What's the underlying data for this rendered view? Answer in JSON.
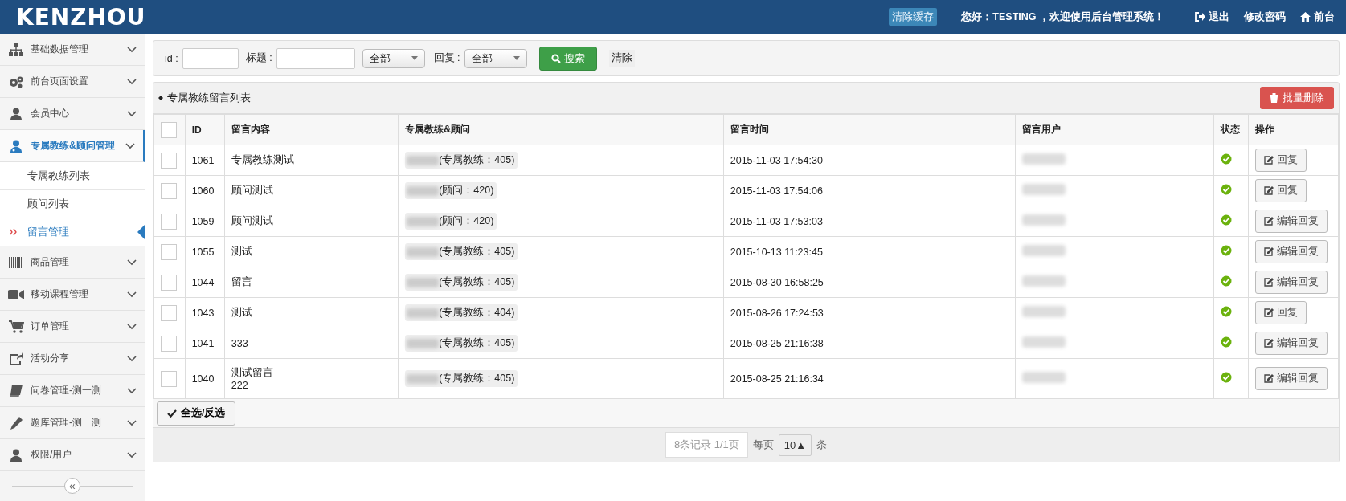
{
  "header": {
    "logo": "KENZHOU",
    "clear_cache": "清除缓存",
    "welcome": "您好：TESTING ，欢迎使用后台管理系统！",
    "links": [
      {
        "kind": "logout",
        "label": "退出"
      },
      {
        "kind": "password",
        "label": "修改密码"
      },
      {
        "kind": "home",
        "label": "前台"
      }
    ]
  },
  "sidebar": {
    "items": [
      {
        "label": "基础数据管理",
        "expanded": false
      },
      {
        "label": "前台页面设置",
        "expanded": false
      },
      {
        "label": "会员中心",
        "expanded": false
      },
      {
        "label": "专属教练&顾问管理",
        "expanded": true,
        "children": [
          {
            "label": "专属教练列表",
            "selected": false
          },
          {
            "label": "顾问列表",
            "selected": false
          },
          {
            "label": "留言管理",
            "selected": true
          }
        ]
      },
      {
        "label": "商品管理",
        "expanded": false
      },
      {
        "label": "移动课程管理",
        "expanded": false
      },
      {
        "label": "订单管理",
        "expanded": false
      },
      {
        "label": "活动分享",
        "expanded": false
      },
      {
        "label": "问卷管理-测一测",
        "expanded": false
      },
      {
        "label": "题库管理-测一测",
        "expanded": false
      },
      {
        "label": "权限/用户",
        "expanded": false
      }
    ],
    "collapse": "«"
  },
  "filter": {
    "id_label": "id :",
    "title_label": "标题 :",
    "type_select": "全部",
    "reply_label": "回复 :",
    "reply_select": "全部",
    "search": "搜索",
    "clear": "清除"
  },
  "list": {
    "title": "专属教练留言列表",
    "batch_delete": "批量删除",
    "all_checked": false,
    "columns": [
      "ID",
      "留言内容",
      "专属教练&顾问",
      "留言时间",
      "留言用户",
      "状态",
      "操作"
    ],
    "rows": [
      {
        "checked": false,
        "id": "1061",
        "content": [
          "专属教练测试"
        ],
        "coach": "(专属教练：405)",
        "time": "2015-11-03 17:54:30",
        "ok": true,
        "action": "回复"
      },
      {
        "checked": false,
        "id": "1060",
        "content": [
          "顾问测试"
        ],
        "coach": "(顾问：420)",
        "time": "2015-11-03 17:54:06",
        "ok": true,
        "action": "回复"
      },
      {
        "checked": false,
        "id": "1059",
        "content": [
          "顾问测试"
        ],
        "coach": "(顾问：420)",
        "time": "2015-11-03 17:53:03",
        "ok": true,
        "action": "编辑回复"
      },
      {
        "checked": false,
        "id": "1055",
        "content": [
          "测试"
        ],
        "coach": "(专属教练：405)",
        "time": "2015-10-13 11:23:45",
        "ok": true,
        "action": "编辑回复"
      },
      {
        "checked": false,
        "id": "1044",
        "content": [
          "留言"
        ],
        "coach": "(专属教练：405)",
        "time": "2015-08-30 16:58:25",
        "ok": true,
        "action": "编辑回复"
      },
      {
        "checked": false,
        "id": "1043",
        "content": [
          "测试"
        ],
        "coach": "(专属教练：404)",
        "time": "2015-08-26 17:24:53",
        "ok": true,
        "action": "回复"
      },
      {
        "checked": false,
        "id": "1041",
        "content": [
          "333"
        ],
        "coach": "(专属教练：405)",
        "time": "2015-08-25 21:16:38",
        "ok": true,
        "action": "编辑回复"
      },
      {
        "checked": false,
        "id": "1040",
        "content": [
          "测试留言",
          "222"
        ],
        "coach": "(专属教练：405)",
        "time": "2015-08-25 21:16:34",
        "ok": true,
        "action": "编辑回复"
      }
    ],
    "select_all": "全选/反选",
    "pager": {
      "summary": "8条记录 1/1页",
      "per_page": "每页",
      "size": "10▲",
      "unit": "条"
    }
  }
}
